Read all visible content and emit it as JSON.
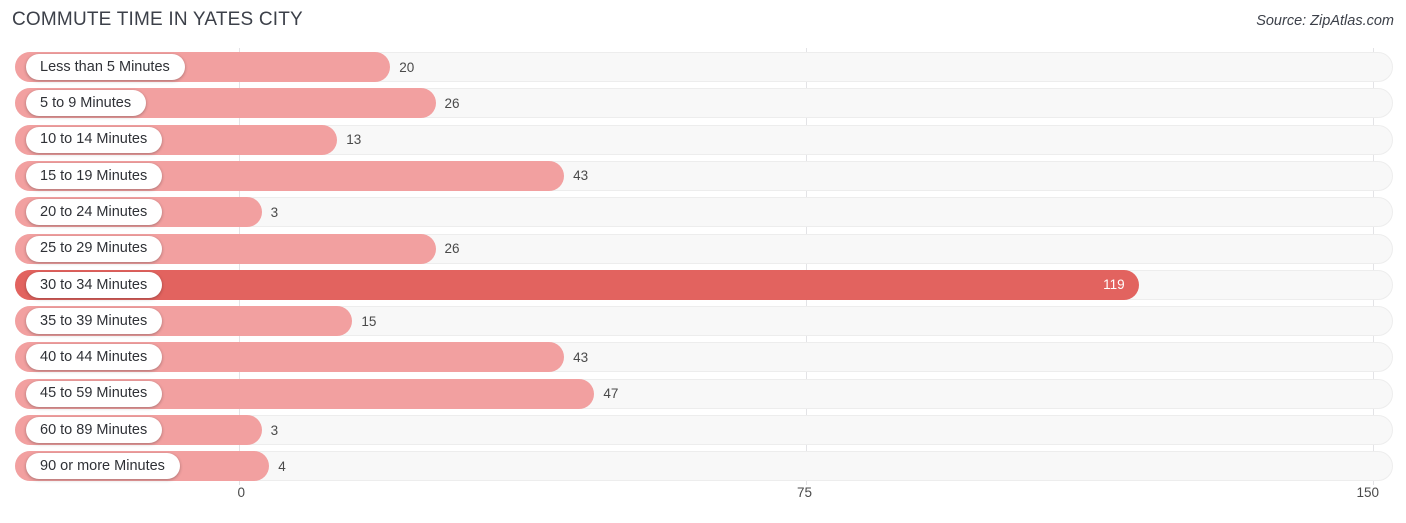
{
  "header": {
    "title": "COMMUTE TIME IN YATES CITY",
    "source": "Source: ZipAtlas.com"
  },
  "chart_data": {
    "type": "bar",
    "orientation": "horizontal",
    "title": "COMMUTE TIME IN YATES CITY",
    "xlabel": "",
    "ylabel": "",
    "xlim": [
      0,
      150
    ],
    "xticks": [
      0,
      75,
      150
    ],
    "xtick_labels": [
      "0",
      "75",
      "150"
    ],
    "grid": true,
    "legend": false,
    "categories": [
      "Less than 5 Minutes",
      "5 to 9 Minutes",
      "10 to 14 Minutes",
      "15 to 19 Minutes",
      "20 to 24 Minutes",
      "25 to 29 Minutes",
      "30 to 34 Minutes",
      "35 to 39 Minutes",
      "40 to 44 Minutes",
      "45 to 59 Minutes",
      "60 to 89 Minutes",
      "90 or more Minutes"
    ],
    "values": [
      20,
      26,
      13,
      43,
      3,
      26,
      119,
      15,
      43,
      47,
      3,
      4
    ],
    "value_labels": [
      "20",
      "26",
      "13",
      "43",
      "3",
      "26",
      "119",
      "15",
      "43",
      "47",
      "3",
      "4"
    ],
    "highlight_index": 6,
    "colors": {
      "bar": "#f2a0a0",
      "bar_max": "#e2635f",
      "track": "#f8f8f8",
      "gridline": "#e3e3e6",
      "text": "#3c4049",
      "value_inside_text": "#ffffff"
    }
  }
}
